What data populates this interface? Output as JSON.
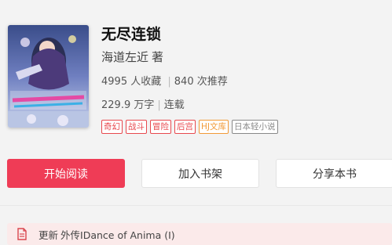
{
  "book": {
    "title": "无尽连锁",
    "author": "海道左近",
    "author_suffix": "著",
    "favorites": "4995",
    "favorites_label": "人收藏",
    "recommends": "840",
    "recommends_label": "次推荐",
    "word_count": "229.9 万字",
    "status": "连载",
    "tags": [
      {
        "label": "奇幻",
        "color": "#e8484e"
      },
      {
        "label": "战斗",
        "color": "#e8484e"
      },
      {
        "label": "冒险",
        "color": "#e8484e"
      },
      {
        "label": "后宫",
        "color": "#e8484e"
      },
      {
        "label": "HJ文库",
        "color": "#f29a38"
      },
      {
        "label": "日本轻小说",
        "color": "#888888"
      }
    ]
  },
  "actions": {
    "read": "开始阅读",
    "add_shelf": "加入书架",
    "share": "分享本书"
  },
  "update": {
    "prefix": "更新",
    "chapter": "外传IDance of Anima (I)"
  },
  "colors": {
    "accent": "#ef3c56",
    "tag_red": "#e8484e",
    "tag_orange": "#f29a38",
    "tag_gray": "#888888",
    "update_bg": "#fbeaea"
  }
}
